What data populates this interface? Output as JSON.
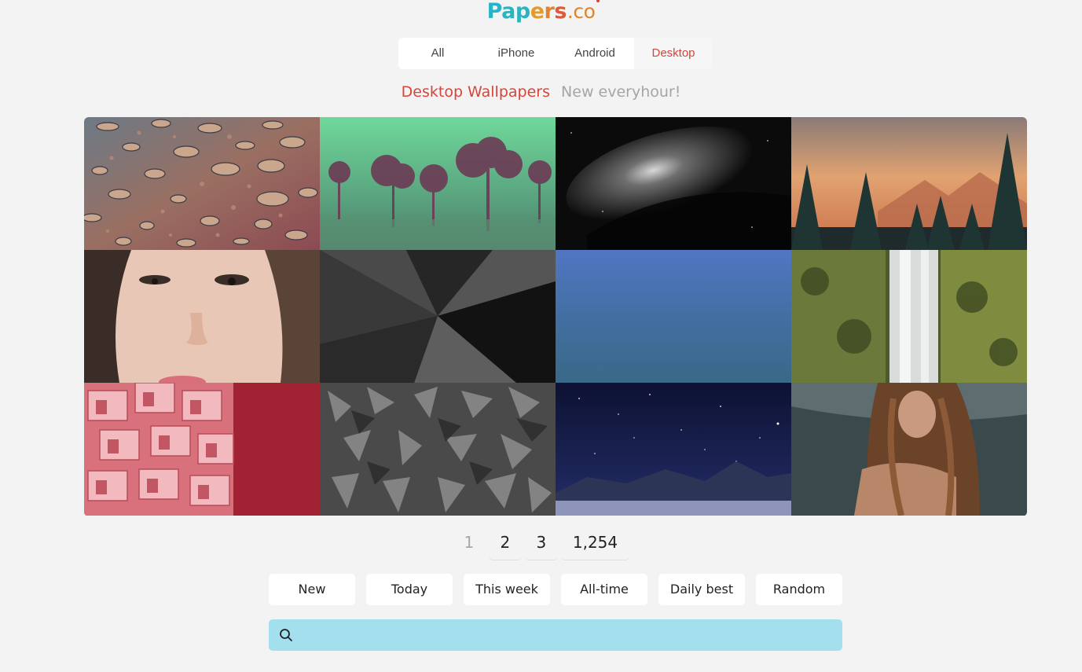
{
  "logo": {
    "letters": [
      "P",
      "a",
      "p",
      "e",
      "r",
      "s"
    ],
    "domain": ".co"
  },
  "tabs": [
    {
      "label": "All",
      "active": false
    },
    {
      "label": "iPhone",
      "active": false
    },
    {
      "label": "Android",
      "active": false
    },
    {
      "label": "Desktop",
      "active": true
    }
  ],
  "headline": {
    "title": "Desktop Wallpapers",
    "subtitle": "New everyhour!"
  },
  "wallpapers": [
    {
      "name": "water-droplets"
    },
    {
      "name": "green-fog-trees"
    },
    {
      "name": "black-white-nebula"
    },
    {
      "name": "forest-sunset-mountains"
    },
    {
      "name": "girl-face-closeup"
    },
    {
      "name": "brushed-metal-swirl"
    },
    {
      "name": "blue-gradient"
    },
    {
      "name": "mossy-waterfall"
    },
    {
      "name": "pink-balconies-building"
    },
    {
      "name": "gray-crystal-texture"
    },
    {
      "name": "starry-night-mountains"
    },
    {
      "name": "woman-long-hair"
    }
  ],
  "pagination": {
    "pages": [
      "1",
      "2",
      "3",
      "1,254"
    ],
    "current": "1"
  },
  "sort_buttons": [
    "New",
    "Today",
    "This week",
    "All-time",
    "Daily best",
    "Random"
  ],
  "search": {
    "value": "",
    "placeholder": "",
    "icon": "search-icon"
  },
  "colors": {
    "accent": "#d6453a",
    "search_bg": "#a4dfee",
    "page_bg": "#f3f3f3"
  }
}
